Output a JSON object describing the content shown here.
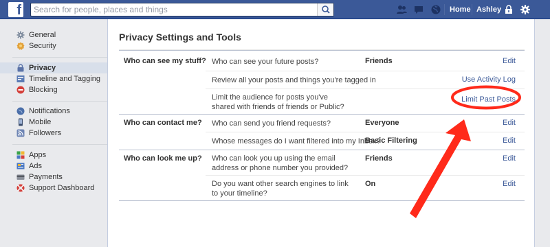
{
  "topbar": {
    "logo": "f",
    "search_placeholder": "Search for people, places and things",
    "nav": {
      "home": "Home",
      "profile": "Ashley"
    }
  },
  "sidebar": {
    "groups": [
      [
        {
          "label": "General",
          "icon": "gear-icon",
          "color": "#7f8c9e"
        },
        {
          "label": "Security",
          "icon": "badge-icon",
          "color": "#e3a23b"
        }
      ],
      [
        {
          "label": "Privacy",
          "icon": "lock-icon",
          "color": "#5b73a8",
          "active": true
        },
        {
          "label": "Timeline and Tagging",
          "icon": "timeline-icon",
          "color": "#5a7bb5"
        },
        {
          "label": "Blocking",
          "icon": "block-icon",
          "color": "#d43f3a"
        }
      ],
      [
        {
          "label": "Notifications",
          "icon": "globe-icon",
          "color": "#4a6ea9"
        },
        {
          "label": "Mobile",
          "icon": "mobile-icon",
          "color": "#3c4e6e"
        },
        {
          "label": "Followers",
          "icon": "rss-icon",
          "color": "#6d84b4"
        }
      ],
      [
        {
          "label": "Apps",
          "icon": "apps-icon",
          "color": "#3aa34a"
        },
        {
          "label": "Ads",
          "icon": "ads-icon",
          "color": "#4a78c4"
        },
        {
          "label": "Payments",
          "icon": "payments-icon",
          "color": "#8a8f99"
        },
        {
          "label": "Support Dashboard",
          "icon": "lifebuoy-icon",
          "color": "#d43f3a"
        }
      ]
    ]
  },
  "main": {
    "title": "Privacy Settings and Tools",
    "sections": [
      {
        "label": "Who can see my stuff?",
        "rows": [
          {
            "question": "Who can see your future posts?",
            "value": "Friends",
            "action": "Edit"
          },
          {
            "question": "Review all your posts and things you're tagged in",
            "value": "",
            "action": "Use Activity Log"
          },
          {
            "question": "Limit the audience for posts you've shared with friends of friends or Public?",
            "value": "",
            "action": "Limit Past Posts"
          }
        ]
      },
      {
        "label": "Who can contact me?",
        "rows": [
          {
            "question": "Who can send you friend requests?",
            "value": "Everyone",
            "action": "Edit"
          },
          {
            "question": "Whose messages do I want filtered into my Inbox?",
            "value": "Basic Filtering",
            "action": "Edit"
          }
        ]
      },
      {
        "label": "Who can look me up?",
        "rows": [
          {
            "question": "Who can look you up using the email address or phone number you provided?",
            "value": "Friends",
            "action": "Edit"
          },
          {
            "question": "Do you want other search engines to link to your timeline?",
            "value": "On",
            "action": "Edit"
          }
        ]
      }
    ]
  },
  "annotation": {
    "color": "#ff2a1a"
  }
}
